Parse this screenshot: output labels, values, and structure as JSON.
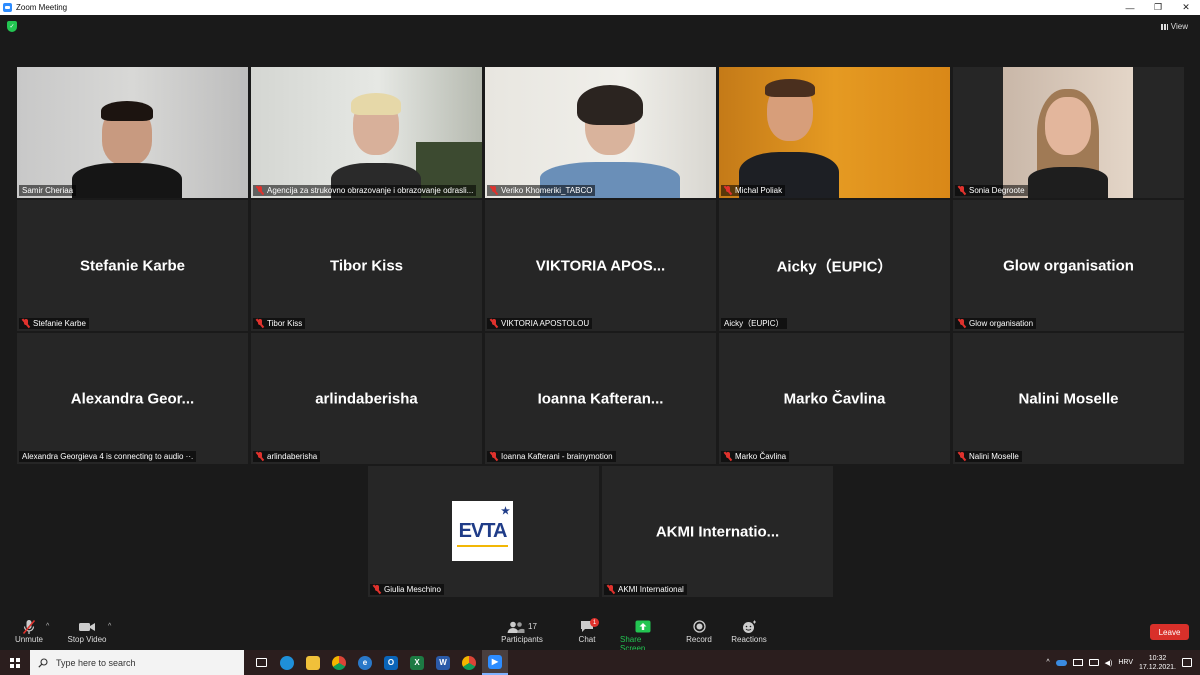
{
  "window": {
    "title": "Zoom Meeting",
    "minimize": "—",
    "restore": "❐",
    "close": "✕"
  },
  "header": {
    "view_label": "View"
  },
  "tiles": [
    {
      "big_name": "",
      "label": "Samir Cheriaa"
    },
    {
      "big_name": "",
      "label": "Agencija za strukovno obrazovanje i obrazovanje odrasli..."
    },
    {
      "big_name": "",
      "label": "Veriko Khomeriki_TABCO"
    },
    {
      "big_name": "",
      "label": "Michal Poliak"
    },
    {
      "big_name": "",
      "label": "Sonia Degroote"
    },
    {
      "big_name": "Stefanie Karbe",
      "label": "Stefanie Karbe"
    },
    {
      "big_name": "Tibor Kiss",
      "label": "Tibor Kiss"
    },
    {
      "big_name": "VIKTORIA  APOS...",
      "label": "VIKTORIA APOSTOLOU"
    },
    {
      "big_name": "Aicky（EUPIC）",
      "label": "Aicky（EUPIC）"
    },
    {
      "big_name": "Glow organisation",
      "label": "Glow organisation"
    },
    {
      "big_name": "Alexandra  Geor...",
      "label": "Alexandra Georgieva 4 is connecting to audio ··."
    },
    {
      "big_name": "arlindaberisha",
      "label": "arlindaberisha"
    },
    {
      "big_name": "Ioanna  Kafteran...",
      "label": "Ioanna Kafterani - brainymotion"
    },
    {
      "big_name": "Marko Čavlina",
      "label": "Marko Čavlina"
    },
    {
      "big_name": "Nalini Moselle",
      "label": "Nalini Moselle"
    },
    {
      "big_name": "",
      "label": "Giulia Meschino",
      "logo_text": "EVTA"
    },
    {
      "big_name": "AKMI  Internatio...",
      "label": "AKMI International"
    }
  ],
  "toolbar": {
    "unmute": "Unmute",
    "stop_video": "Stop Video",
    "participants": "Participants",
    "participants_count": "17",
    "chat": "Chat",
    "chat_badge": "1",
    "share_screen": "Share Screen",
    "record": "Record",
    "reactions": "Reactions",
    "leave": "Leave"
  },
  "taskbar": {
    "search_placeholder": "Type here to search",
    "language": "HRV",
    "time": "10:32",
    "date": "17.12.2021."
  },
  "colors": {
    "accent_green": "#23c552",
    "active_speaker": "#d7e84a",
    "leave_red": "#d9302a",
    "muted_red": "#e0322d"
  }
}
